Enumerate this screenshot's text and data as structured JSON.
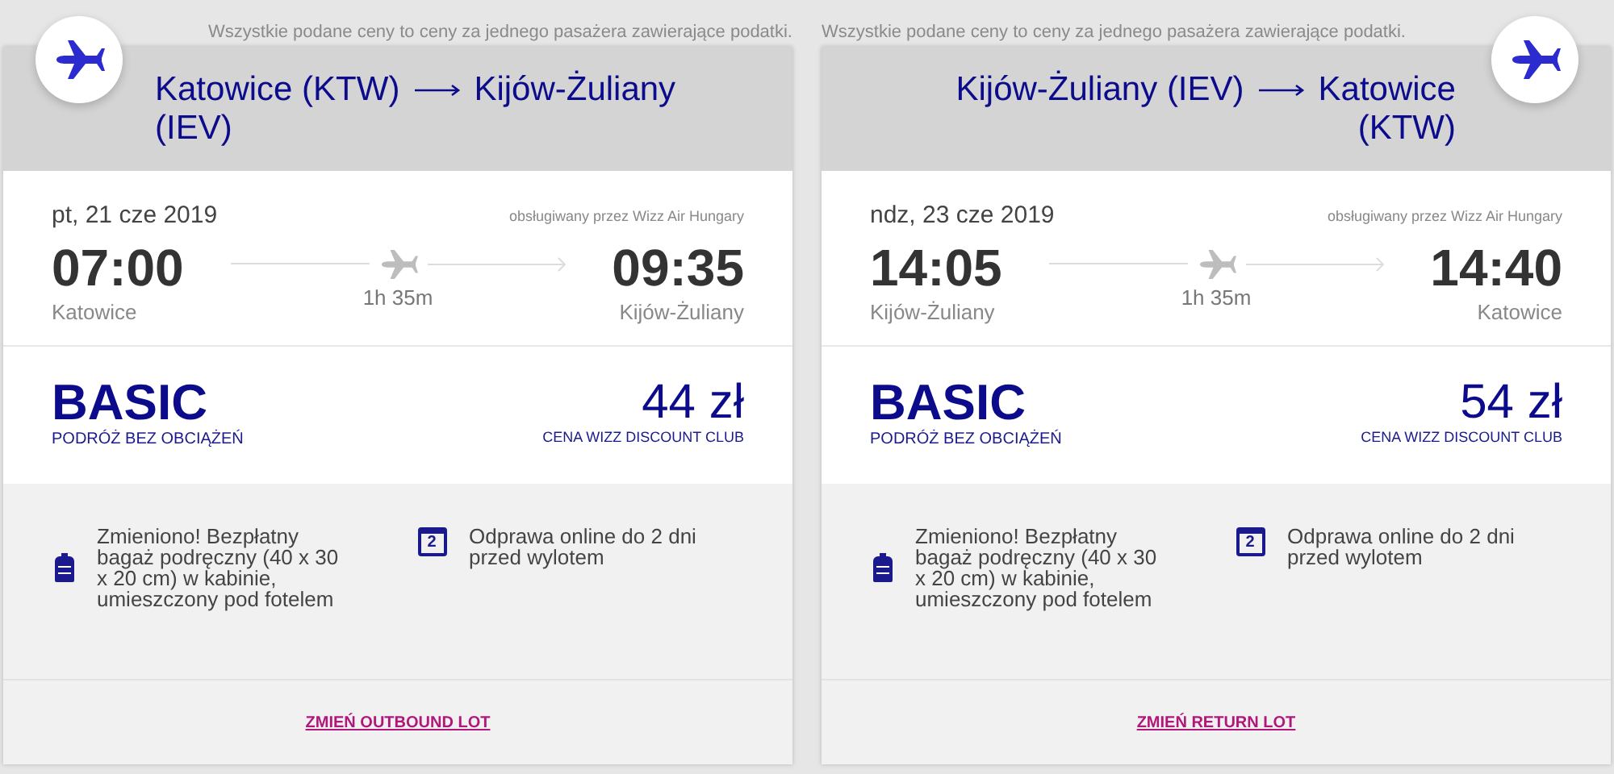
{
  "cards": [
    {
      "kind": "outbound",
      "notice": "Wszystkie podane ceny to ceny za jednego pasażera zawierające podatki.",
      "origin": "Katowice (KTW)",
      "destination": "Kijów-Żuliany (IEV)",
      "date": "pt, 21 cze 2019",
      "operator": "obsługiwany przez Wizz Air Hungary",
      "depart_time": "07:00",
      "depart_city": "Katowice",
      "duration": "1h 35m",
      "arrive_time": "09:35",
      "arrive_city": "Kijów-Żuliany",
      "fare": "BASIC",
      "fare_note": "PODRÓŻ BEZ OBCIĄŻEŃ",
      "price": "44 zł",
      "price_note": "CENA WIZZ DISCOUNT CLUB",
      "features": [
        {
          "kind": "bag",
          "text": "Zmieniono! Bezpłatny bagaż podręczny (40 x 30 x 20 cm) w kabinie, umieszczony pod fotelem"
        },
        {
          "kind": "calendar",
          "icon_text": "2",
          "text": "Odprawa online do 2 dni przed wylotem"
        }
      ],
      "change_link": "ZMIEŃ OUTBOUND LOT"
    },
    {
      "kind": "return",
      "notice": "Wszystkie podane ceny to ceny za jednego pasażera zawierające podatki.",
      "origin": "Kijów-Żuliany (IEV)",
      "destination": "Katowice (KTW)",
      "date": "ndz, 23 cze 2019",
      "operator": "obsługiwany przez Wizz Air Hungary",
      "depart_time": "14:05",
      "depart_city": "Kijów-Żuliany",
      "duration": "1h 35m",
      "arrive_time": "14:40",
      "arrive_city": "Katowice",
      "fare": "BASIC",
      "fare_note": "PODRÓŻ BEZ OBCIĄŻEŃ",
      "price": "54 zł",
      "price_note": "CENA WIZZ DISCOUNT CLUB",
      "features": [
        {
          "kind": "bag",
          "text": "Zmieniono! Bezpłatny bagaż podręczny (40 x 30 x 20 cm) w kabinie, umieszczony pod fotelem"
        },
        {
          "kind": "calendar",
          "icon_text": "2",
          "text": "Odprawa online do 2 dni przed wylotem"
        }
      ],
      "change_link": "ZMIEŃ RETURN LOT"
    }
  ]
}
